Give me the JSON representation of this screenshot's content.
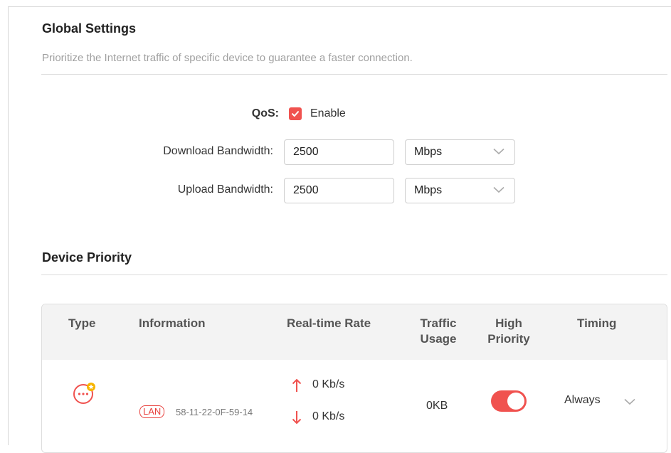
{
  "global": {
    "title": "Global Settings",
    "description": "Prioritize the Internet traffic of specific device to guarantee a faster connection.",
    "qos_label": "QoS:",
    "qos_checkbox_label": "Enable",
    "qos_enabled": true,
    "download_label": "Download Bandwidth:",
    "download_value": "2500",
    "download_unit": "Mbps",
    "upload_label": "Upload Bandwidth:",
    "upload_value": "2500",
    "upload_unit": "Mbps"
  },
  "device_priority": {
    "title": "Device Priority",
    "columns": {
      "type": "Type",
      "information": "Information",
      "realtime_rate": "Real-time Rate",
      "traffic_usage_line1": "Traffic",
      "traffic_usage_line2": "Usage",
      "high_priority_line1": "High",
      "high_priority_line2": "Priority",
      "timing": "Timing"
    },
    "rows": [
      {
        "type_icon": "more-device-icon",
        "badge": "LAN",
        "mac": "58-11-22-0F-59-14",
        "upload_rate": "0 Kb/s",
        "download_rate": "0 Kb/s",
        "traffic_usage": "0KB",
        "high_priority": true,
        "timing": "Always"
      }
    ]
  },
  "colors": {
    "accent": "#f0524f",
    "badge_red": "#e8403d",
    "header_bg": "#f3f3f3"
  }
}
